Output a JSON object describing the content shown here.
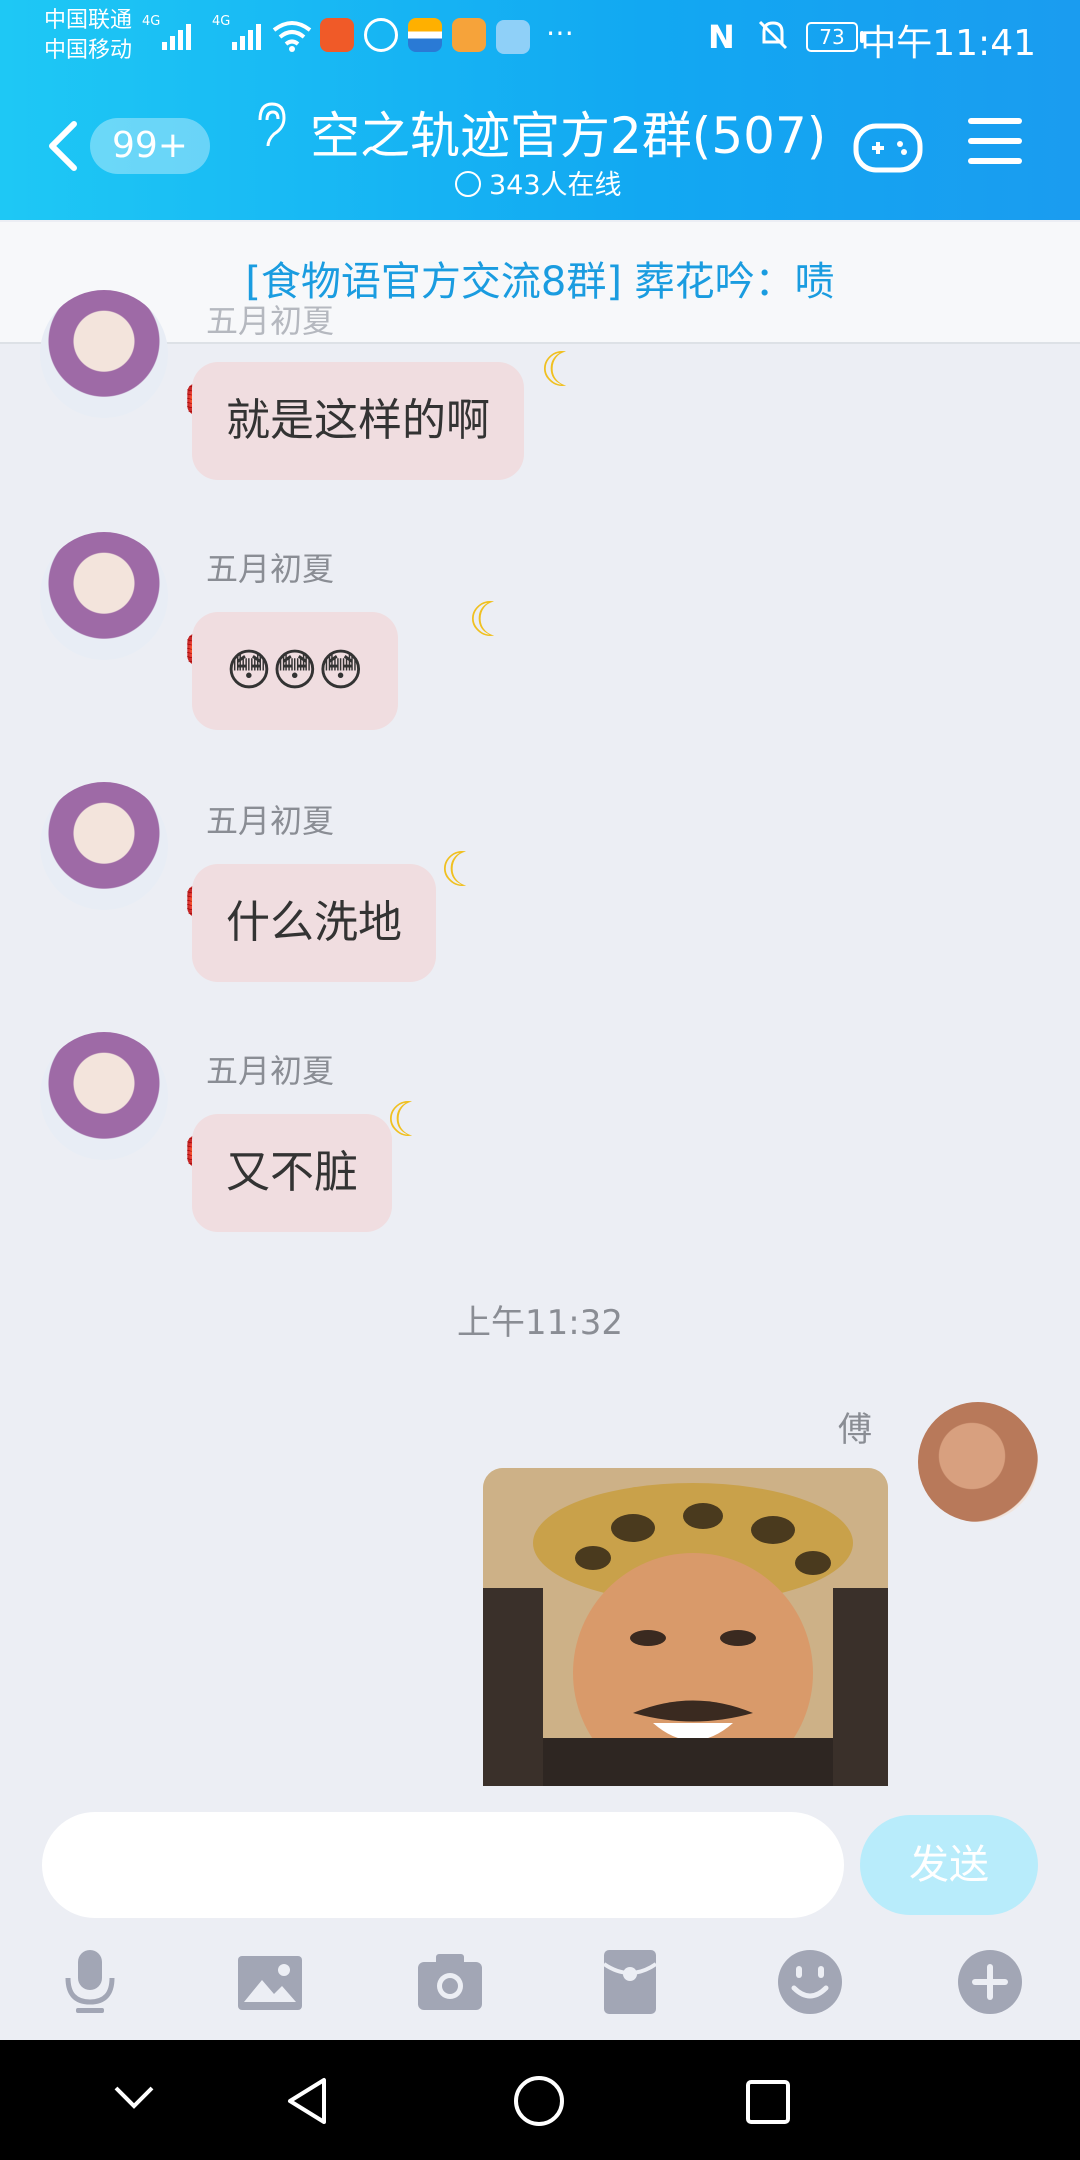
{
  "status_bar": {
    "carrier1": "中国联通",
    "carrier2": "中国移动",
    "net1": "4G",
    "net2": "4G",
    "battery": "73",
    "time": "中午11:41"
  },
  "header": {
    "back_badge": "99+",
    "title": "空之轨迹官方2群(507)",
    "online": "343人在线",
    "accent_color": "#1aa6f1"
  },
  "notice": {
    "text": "[食物语官方交流8群] 葬花吟：啧"
  },
  "messages": [
    {
      "sender": "五月初夏",
      "text": "就是这样的啊"
    },
    {
      "sender": "五月初夏",
      "text": "😳😳😳"
    },
    {
      "sender": "五月初夏",
      "text": "什么洗地"
    },
    {
      "sender": "五月初夏",
      "text": "又不脏"
    }
  ],
  "timestamp": "上午11:32",
  "my_message": {
    "sender": "傅",
    "content": "image"
  },
  "composer": {
    "placeholder": "",
    "send_label": "发送"
  },
  "toolbar_icons": [
    "microphone-icon",
    "image-icon",
    "camera-icon",
    "red-packet-icon",
    "emoji-icon",
    "plus-icon"
  ],
  "nav_icons": [
    "chevron-down-icon",
    "back-triangle-icon",
    "home-circle-icon",
    "recents-square-icon"
  ]
}
